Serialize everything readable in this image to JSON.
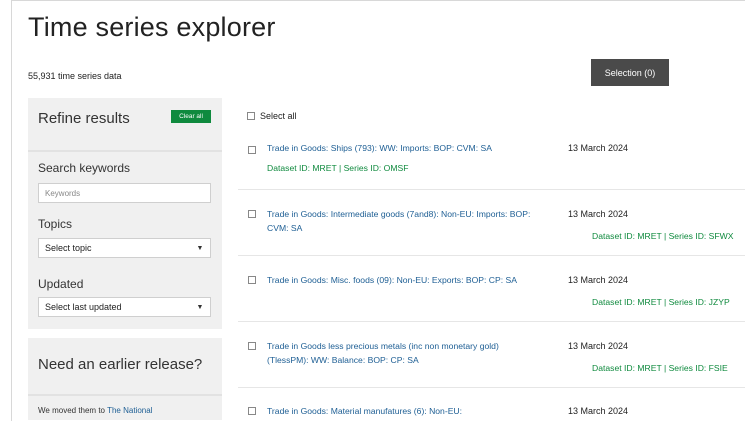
{
  "page": {
    "title": "Time series explorer",
    "count": "55,931 time series data",
    "selection_button": "Selection (0)"
  },
  "sidebar": {
    "refine_title": "Refine results",
    "clear_all": "Clear all",
    "search_label": "Search keywords",
    "search_placeholder": "Keywords",
    "topics_label": "Topics",
    "topics_value": "Select topic",
    "updated_label": "Updated",
    "updated_value": "Select last updated"
  },
  "release": {
    "title": "Need an earlier release?",
    "text_prefix": "We moved them to ",
    "link": "The National"
  },
  "results": {
    "select_all": "Select all",
    "items": [
      {
        "title": "Trade in Goods: Ships (793): WW: Imports: BOP: CVM: SA",
        "date": "13 March 2024",
        "meta": "Dataset ID: MRET | Series ID: OMSF"
      },
      {
        "title": "Trade in Goods: Intermediate goods (7and8): Non-EU: Imports: BOP: CVM: SA",
        "date": "13 March 2024",
        "meta": "Dataset ID: MRET | Series ID: SFWX"
      },
      {
        "title": "Trade in Goods: Misc. foods (09): Non-EU: Exports: BOP: CP: SA",
        "date": "13 March 2024",
        "meta": "Dataset ID: MRET | Series ID: JZYP"
      },
      {
        "title": "Trade in Goods less precious metals (inc non monetary gold) (TlessPM): WW: Balance: BOP: CP: SA",
        "date": "13 March 2024",
        "meta": "Dataset ID: MRET | Series ID: FSIE"
      },
      {
        "title": "Trade in Goods: Material manufatures (6): Non-EU:",
        "date": "13 March 2024",
        "meta": ""
      }
    ]
  }
}
